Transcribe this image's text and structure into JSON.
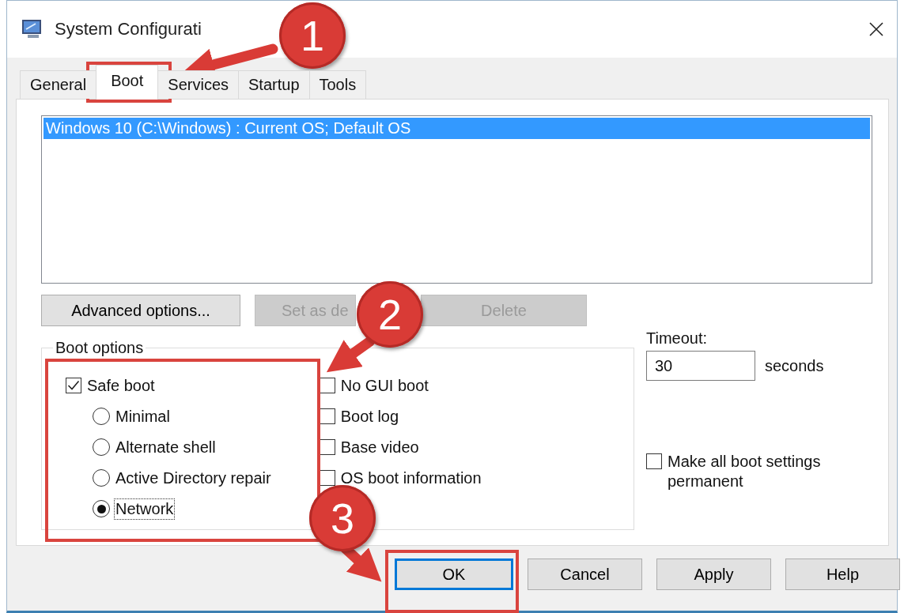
{
  "window": {
    "title": "System Configurati"
  },
  "tabs": [
    {
      "label": "General",
      "selected": false
    },
    {
      "label": "Boot",
      "selected": true
    },
    {
      "label": "Services",
      "selected": false
    },
    {
      "label": "Startup",
      "selected": false
    },
    {
      "label": "Tools",
      "selected": false
    }
  ],
  "boot_entries": [
    {
      "label": "Windows 10 (C:\\Windows) : Current OS; Default OS",
      "selected": true
    }
  ],
  "entry_buttons": [
    {
      "label": "Advanced options...",
      "disabled": false
    },
    {
      "label": "Set as de",
      "disabled": true
    },
    {
      "label": "Delete",
      "disabled": true
    }
  ],
  "boot_options": {
    "title": "Boot options",
    "safe_boot": {
      "label": "Safe boot",
      "checked": true
    },
    "safe_boot_modes": [
      {
        "label": "Minimal",
        "selected": false
      },
      {
        "label": "Alternate shell",
        "selected": false
      },
      {
        "label": "Active Directory repair",
        "selected": false
      },
      {
        "label": "Network",
        "selected": true
      }
    ],
    "flags": [
      {
        "label": "No GUI boot",
        "checked": false
      },
      {
        "label": "Boot log",
        "checked": false
      },
      {
        "label": "Base video",
        "checked": false
      },
      {
        "label": "OS boot information",
        "checked": false
      }
    ]
  },
  "timeout": {
    "label": "Timeout:",
    "value": "30",
    "unit": "seconds"
  },
  "permanent": {
    "label": "Make all boot settings permanent",
    "checked": false
  },
  "buttons": [
    {
      "label": "OK",
      "default": true
    },
    {
      "label": "Cancel",
      "default": false
    },
    {
      "label": "Apply",
      "default": false
    },
    {
      "label": "Help",
      "default": false
    }
  ],
  "annotations": [
    {
      "number": "1"
    },
    {
      "number": "2"
    },
    {
      "number": "3"
    }
  ]
}
